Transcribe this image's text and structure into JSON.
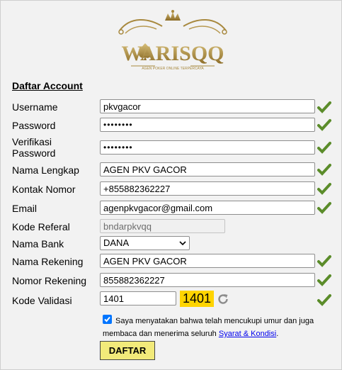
{
  "logo": {
    "text": "WARISQQ",
    "tagline": "AGEN POKER ONLINE TERPERCAYA"
  },
  "form": {
    "heading": "Daftar Account",
    "username": {
      "label": "Username",
      "value": "pkvgacor"
    },
    "password": {
      "label": "Password",
      "value": "••••••••"
    },
    "verify": {
      "label_line1": "Verifikasi",
      "label_line2": "Password",
      "value": "••••••••"
    },
    "fullname": {
      "label": "Nama Lengkap",
      "value": "AGEN PKV GACOR"
    },
    "phone": {
      "label": "Kontak Nomor",
      "value": "+855882362227"
    },
    "email": {
      "label": "Email",
      "value": "agenpkvgacor@gmail.com"
    },
    "referral": {
      "label": "Kode Referal",
      "value": "bndarpkvqq"
    },
    "bank": {
      "label": "Nama Bank",
      "value": "DANA"
    },
    "account_name": {
      "label": "Nama Rekening",
      "value": "AGEN PKV GACOR"
    },
    "account_number": {
      "label": "Nomor Rekening",
      "value": "855882362227"
    },
    "captcha": {
      "label": "Kode Validasi",
      "value": "1401",
      "code": "1401"
    },
    "agreement": {
      "text": "Saya menyatakan bahwa telah mencukupi umur dan juga membaca dan menerima seluruh",
      "link": "Syarat & Kondisi",
      "suffix": ".",
      "checked": true
    },
    "submit_label": "DAFTAR"
  },
  "icons": {
    "valid": "checkmark-icon",
    "refresh": "refresh-icon"
  },
  "colors": {
    "valid_check": "#5b8c2a",
    "captcha_bg": "#ffd400",
    "button_bg": "#f2ea7a",
    "logo_gold": "#a8893f"
  }
}
